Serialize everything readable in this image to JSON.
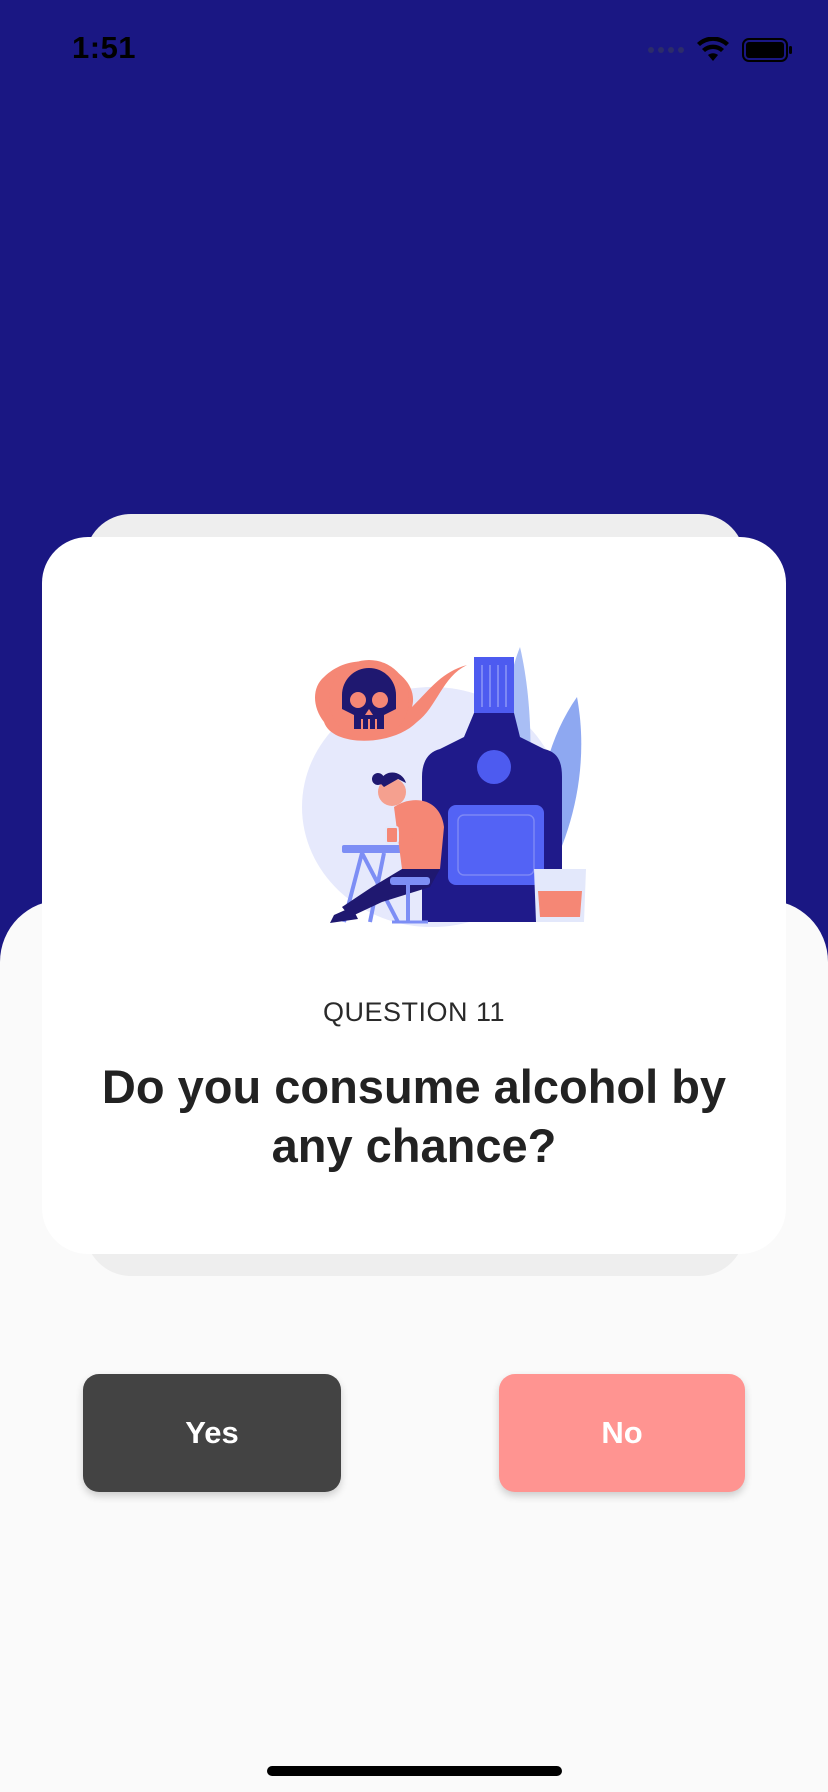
{
  "status_bar": {
    "time": "1:51",
    "icons": [
      "signal-icon",
      "wifi-icon",
      "battery-icon"
    ]
  },
  "colors": {
    "header_background": "#1A1783",
    "yes_button": "#434343",
    "no_button": "#FF9491",
    "sheet_background": "#FAFAFA"
  },
  "question": {
    "number_label": "QUESTION 11",
    "text": "Do you consume alcohol by any chance?",
    "illustration": "alcohol-illustration"
  },
  "answers": {
    "yes_label": "Yes",
    "no_label": "No"
  }
}
